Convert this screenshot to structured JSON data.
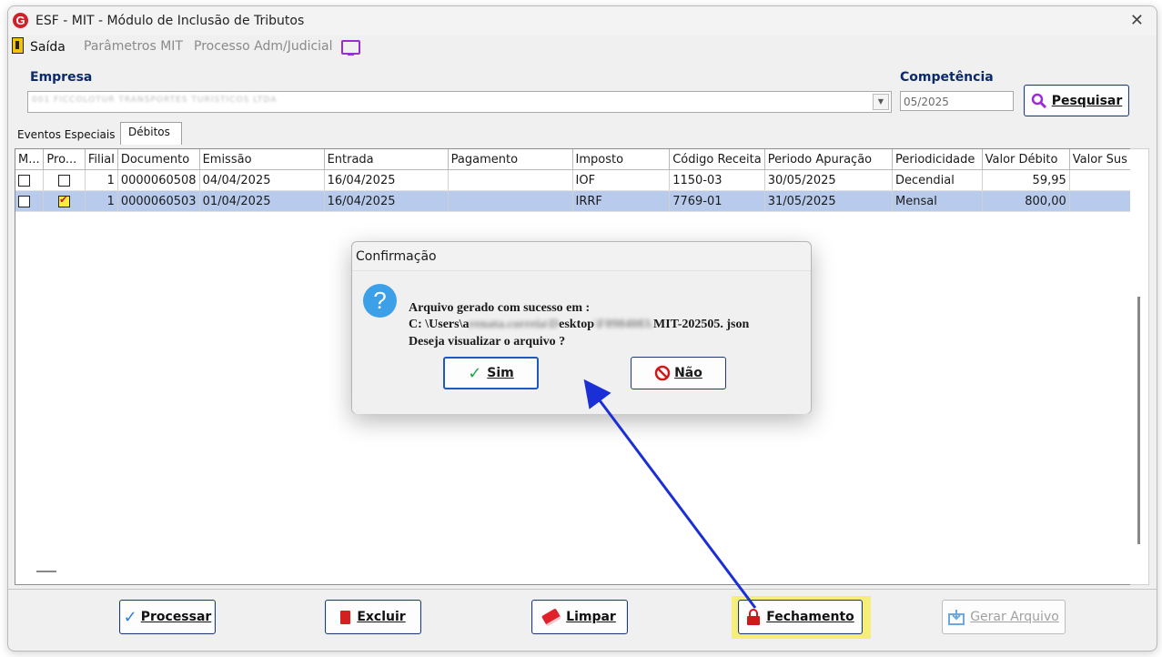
{
  "window": {
    "title": "ESF - MIT - Módulo de Inclusão de Tributos"
  },
  "menu": {
    "exit": "Saída",
    "params": "Parâmetros MIT",
    "process": "Processo Adm/Judicial"
  },
  "header": {
    "empresa_label": "Empresa",
    "empresa_value": "001 FICCOLOTUR TRANSPORTES TURÍSTICOS LTDA",
    "competencia_label": "Competência",
    "competencia_value": "05/2025",
    "search_button": "Pesquisar"
  },
  "tabs": [
    {
      "label": "Eventos Especiais"
    },
    {
      "label": "Débitos"
    }
  ],
  "grid": {
    "columns": [
      "M...",
      "Pro...",
      "Filial",
      "Documento",
      "Emissão",
      "Entrada",
      "Pagamento",
      "Imposto",
      "Código Receita",
      "Periodo Apuração",
      "Periodicidade",
      "Valor Débito",
      "Valor Sus"
    ],
    "rows": [
      {
        "filial": "1",
        "documento": "0000060508",
        "emissao": "04/04/2025",
        "entrada": "16/04/2025",
        "pagamento": "",
        "imposto": "IOF",
        "codigo": "1150-03",
        "periodo": "30/05/2025",
        "periodicidade": "Decendial",
        "valor": "59,95",
        "sus": ""
      },
      {
        "filial": "1",
        "documento": "0000060503",
        "emissao": "01/04/2025",
        "entrada": "16/04/2025",
        "pagamento": "",
        "imposto": "IRRF",
        "codigo": "7769-01",
        "periodo": "31/05/2025",
        "periodicidade": "Mensal",
        "valor": "800,00",
        "sus": ""
      }
    ]
  },
  "buttons": {
    "processar": "Processar",
    "excluir": "Excluir",
    "limpar": "Limpar",
    "fechamento": "Fechamento",
    "gerar": "Gerar Arquivo"
  },
  "dialog": {
    "title": "Confirmação",
    "line1": "Arquivo gerado com sucesso em :",
    "path_prefix": "C: \\Users\\a",
    "path_blur1": "renata.correia\\D",
    "path_mid": "esktop",
    "path_blur2": "\\F0984083.",
    "path_suffix": "MIT-202505. json",
    "line3": "Deseja visualizar o arquivo ?",
    "yes": "Sim",
    "no": "Não"
  },
  "colors": {
    "accent_blue": "#1f3a72",
    "selection": "#b9cbec",
    "highlight": "#f5ef7a",
    "arrow": "#1a2fd6"
  }
}
